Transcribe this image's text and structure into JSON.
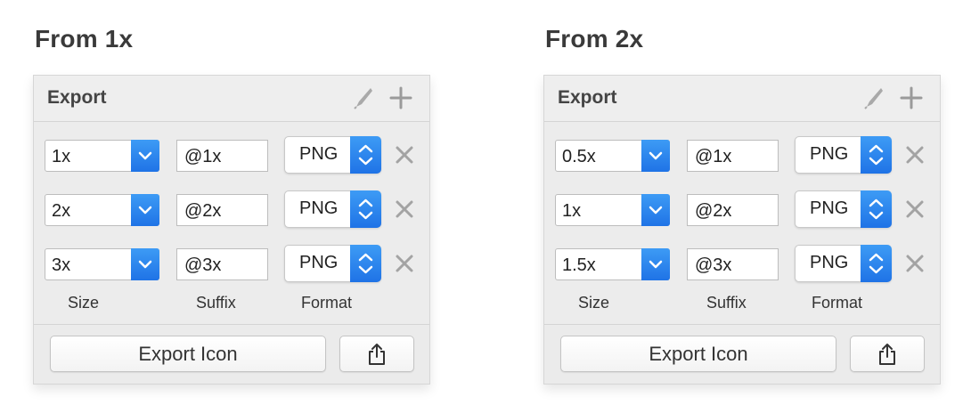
{
  "sections": [
    {
      "title": "From 1x",
      "panel": {
        "title": "Export",
        "rows": [
          {
            "size": "1x",
            "suffix": "@1x",
            "format": "PNG"
          },
          {
            "size": "2x",
            "suffix": "@2x",
            "format": "PNG"
          },
          {
            "size": "3x",
            "suffix": "@3x",
            "format": "PNG"
          }
        ],
        "labels": {
          "size": "Size",
          "suffix": "Suffix",
          "format": "Format"
        },
        "export_button": "Export Icon"
      }
    },
    {
      "title": "From 2x",
      "panel": {
        "title": "Export",
        "rows": [
          {
            "size": "0.5x",
            "suffix": "@1x",
            "format": "PNG"
          },
          {
            "size": "1x",
            "suffix": "@2x",
            "format": "PNG"
          },
          {
            "size": "1.5x",
            "suffix": "@3x",
            "format": "PNG"
          }
        ],
        "labels": {
          "size": "Size",
          "suffix": "Suffix",
          "format": "Format"
        },
        "export_button": "Export Icon"
      }
    }
  ],
  "icons": {
    "pen": "pen-icon",
    "add": "plus-icon",
    "size_dropdown": "chevron-down-icon",
    "format_stepper": "up-down-chevron-icon",
    "remove": "close-icon",
    "share": "share-icon"
  },
  "colors": {
    "accent": "#2a86f0",
    "panel_background": "#ececec"
  }
}
